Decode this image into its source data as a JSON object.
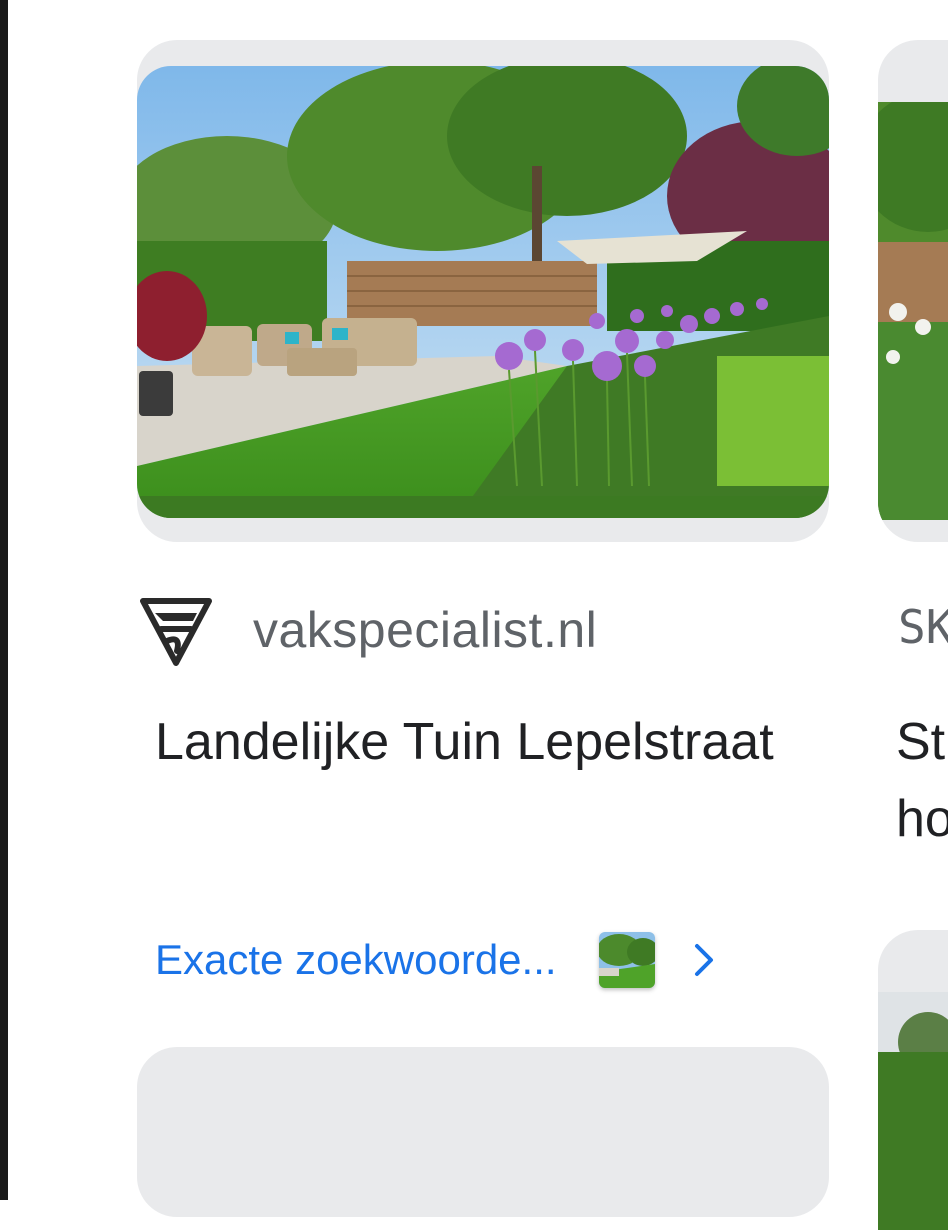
{
  "result_card": {
    "image": {
      "description": "Garden with lounge furniture, lawn and purple allium flowers"
    },
    "source": {
      "logo_icon": "vakspecialist-shield-logo-icon",
      "name": "vakspecialist.nl"
    },
    "title": "Landelijke Tuin Lepelstraat",
    "link": {
      "label": "Exacte zoekwoorde...",
      "thumbnail_icon": "garden-thumbnail",
      "chevron_icon": "chevron-right-icon"
    }
  },
  "peek_card": {
    "source_partial": "SK",
    "title_partial": "St\nho"
  },
  "colors": {
    "link": "#1a73e8",
    "source_text": "#5f6368",
    "title_text": "#202124",
    "placeholder": "#e9eaec"
  }
}
